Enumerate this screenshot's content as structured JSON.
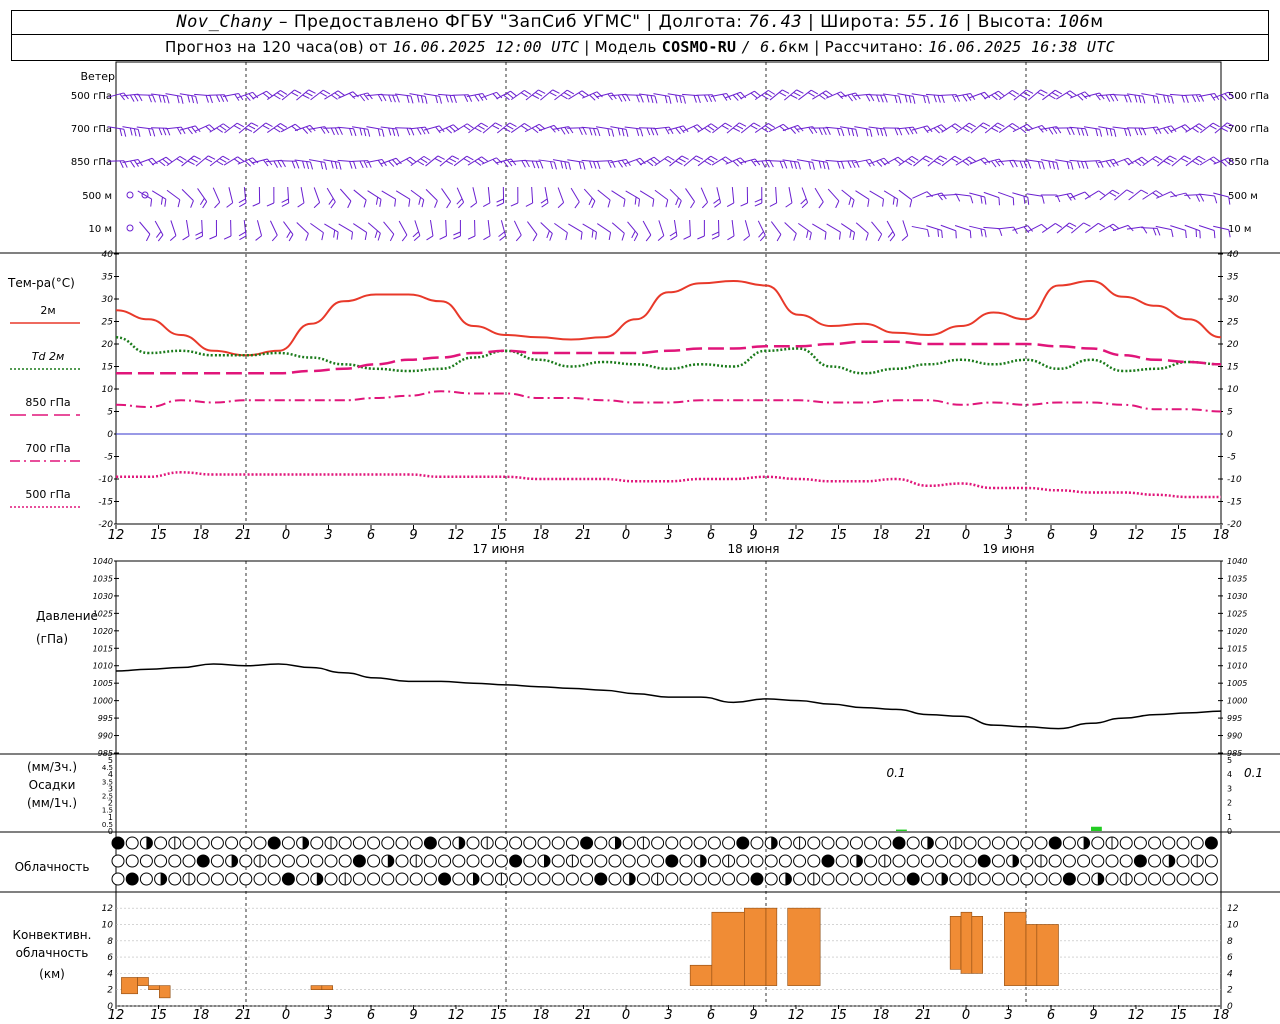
{
  "header": {
    "station": "Nov_Chany",
    "provider": "– Предоставлено ФГБУ \"ЗапСиб УГМС\" |",
    "lon_label": "Долгота:",
    "lon_value": "76.43",
    "lat_label": "| Широта:",
    "lat_value": "55.16",
    "alt_label": "| Высота:",
    "alt_value": "106",
    "alt_unit": "м",
    "forecast_label": "Прогноз на 120 часа(ов) от",
    "forecast_start": "16.06.2025 12:00 UTC",
    "model_label": "| Модель",
    "model_name": "COSMO-RU",
    "model_res": "/ 6.6",
    "model_res_unit": "км",
    "calc_label": "| Рассчитано:",
    "calc_time": "16.06.2025 16:38 UTC"
  },
  "wind_panel": {
    "title": "Ветер",
    "levels": [
      "500 гПа",
      "700 гПа",
      "850 гПа",
      "500 м",
      "10 м"
    ],
    "right_levels": [
      "500 гПа",
      "700 гПа",
      "850 гПа",
      "500 м",
      "10 м"
    ]
  },
  "temp_panel": {
    "title": "Тем-ра(°C)",
    "legend": [
      {
        "label": "2м",
        "style": "solid",
        "color": "#e8392a"
      },
      {
        "label": "Td  2м",
        "style": "dotted-green",
        "color": "#1a7a1a"
      },
      {
        "label": "850 гПа",
        "style": "longdash",
        "color": "#e0157a"
      },
      {
        "label": "700 гПа",
        "style": "dashdot",
        "color": "#e0157a"
      },
      {
        "label": "500 гПа",
        "style": "dotted",
        "color": "#e0157a"
      }
    ]
  },
  "pressure_panel": {
    "title1": "Давление",
    "title2": "(гПа)"
  },
  "precip_panel": {
    "title1": "(мм/3ч.)",
    "title2": "Осадки",
    "title3": "(мм/1ч.)",
    "annotations": [
      {
        "hour": 72,
        "text": "0.1"
      },
      {
        "hour": 105,
        "text": "0.1"
      }
    ]
  },
  "cloud_panel": {
    "title": "Облачность"
  },
  "conv_panel": {
    "title1": "Конвективн.",
    "title2": "облачность",
    "title3": "(км)"
  },
  "time_axis": {
    "hour_labels": [
      "12",
      "15",
      "18",
      "21",
      "0",
      "3",
      "6",
      "9",
      "12",
      "15",
      "18",
      "21",
      "0",
      "3",
      "6",
      "9",
      "12",
      "15",
      "18",
      "21",
      "0",
      "3",
      "6",
      "9",
      "12",
      "15",
      "18"
    ],
    "date_labels": [
      {
        "hour": 36,
        "text": "17 июня"
      },
      {
        "hour": 60,
        "text": "18 июня"
      },
      {
        "hour": 84,
        "text": "19 июня"
      }
    ]
  },
  "colors": {
    "t2m": "#e8392a",
    "td2m": "#1a7a1a",
    "isobaric": "#e0157a",
    "pressure": "#000000",
    "precip": "#22cc22",
    "convective": "#f08c35",
    "convective_edge": "#8c4a10",
    "wind": "#6a1fd0",
    "zero_line": "#3333cc"
  },
  "chart_data": [
    {
      "type": "line",
      "title": "Тем-ра(°C)",
      "ylim": [
        -20,
        40
      ],
      "x_unit": "hours since 16.06.2025 12:00 UTC",
      "x": [
        0,
        3,
        6,
        9,
        12,
        15,
        18,
        21,
        24,
        27,
        30,
        33,
        36,
        39,
        42,
        45,
        48,
        51,
        54,
        57,
        60,
        63,
        66,
        69,
        72,
        75,
        78,
        81,
        84,
        87,
        90,
        93,
        96,
        99,
        102
      ],
      "series": [
        {
          "name": "2м",
          "values": [
            27.5,
            25.5,
            22,
            18.5,
            17.5,
            18.5,
            24.5,
            29.5,
            31,
            31,
            29.5,
            24,
            22,
            21.5,
            21,
            21.5,
            25.5,
            31.5,
            33.5,
            34,
            33,
            26.5,
            24,
            24.5,
            22.5,
            22,
            24,
            27,
            25.5,
            33,
            34,
            30.5,
            28.5,
            25.5,
            21.5
          ]
        },
        {
          "name": "Td  2м",
          "values": [
            21.5,
            18,
            18.5,
            17.5,
            17.5,
            18,
            17,
            15.5,
            14.5,
            14,
            14.5,
            17,
            18.5,
            16.5,
            15,
            16,
            15.5,
            14.5,
            15.5,
            15,
            18.5,
            19,
            15,
            13.5,
            14.5,
            15.5,
            16.5,
            15.5,
            16.5,
            14.5,
            16.5,
            14,
            14.5,
            16,
            15.5
          ]
        },
        {
          "name": "850 гПа",
          "values": [
            13.5,
            13.5,
            13.5,
            13.5,
            13.5,
            13.5,
            14,
            14.5,
            15.5,
            16.5,
            17,
            18,
            18.5,
            18,
            18,
            18,
            18,
            18.5,
            19,
            19,
            19.5,
            19.5,
            20,
            20.5,
            20.5,
            20,
            20,
            20,
            20,
            19.5,
            19,
            17.5,
            16.5,
            16,
            15.5
          ]
        },
        {
          "name": "700 гПа",
          "values": [
            6.5,
            6,
            7.5,
            7,
            7.5,
            7.5,
            7.5,
            7.5,
            8,
            8.5,
            9.5,
            9,
            9,
            8,
            8,
            7.5,
            7,
            7,
            7.5,
            7.5,
            7.5,
            7.5,
            7,
            7,
            7.5,
            7.5,
            6.5,
            7,
            6.5,
            7,
            7,
            6.5,
            5.5,
            5.5,
            5
          ]
        },
        {
          "name": "500 гПа",
          "values": [
            -9.5,
            -9.5,
            -8.5,
            -9,
            -9,
            -9,
            -9,
            -9,
            -9,
            -9,
            -9.5,
            -9.5,
            -9.5,
            -10,
            -10,
            -10,
            -10.5,
            -10.5,
            -10,
            -10,
            -9.5,
            -10,
            -10.5,
            -10.5,
            -10,
            -11.5,
            -11,
            -12,
            -12,
            -12.5,
            -13,
            -13,
            -13.5,
            -14,
            -14
          ]
        }
      ]
    },
    {
      "type": "line",
      "title": "Давление (гПа)",
      "ylim": [
        985,
        1040
      ],
      "x_unit": "hours since 16.06.2025 12:00 UTC",
      "x": [
        0,
        3,
        6,
        9,
        12,
        15,
        18,
        21,
        24,
        27,
        30,
        33,
        36,
        39,
        42,
        45,
        48,
        51,
        54,
        57,
        60,
        63,
        66,
        69,
        72,
        75,
        78,
        81,
        84,
        87,
        90,
        93,
        96,
        99,
        102
      ],
      "series": [
        {
          "name": "Давление",
          "values": [
            1008.5,
            1009,
            1009.5,
            1010.5,
            1010,
            1010.5,
            1009.5,
            1008,
            1006.5,
            1005.5,
            1005.5,
            1005,
            1004.5,
            1004,
            1003.5,
            1003,
            1002,
            1001,
            1001,
            999.5,
            1000.5,
            1000,
            999,
            998,
            997.5,
            996,
            995.5,
            993,
            992.5,
            992,
            993.5,
            995,
            996,
            996.5,
            997
          ]
        }
      ]
    },
    {
      "type": "bar",
      "title": "Осадки (мм/3ч.)",
      "ylim": [
        0,
        5
      ],
      "x_unit": "hours since 16.06.2025 12:00 UTC",
      "bars": [
        {
          "x0": 72,
          "x1": 73,
          "value": 0.1
        },
        {
          "x0": 90,
          "x1": 91,
          "value": 0.3
        }
      ]
    },
    {
      "type": "bar",
      "title": "Конвективн. облачность (км)",
      "ylim": [
        0,
        13
      ],
      "x_unit": "hours since 16.06.2025 12:00 UTC",
      "bars": [
        {
          "x0": 0.5,
          "x1": 2,
          "bottom": 1.5,
          "top": 3.5
        },
        {
          "x0": 2,
          "x1": 3,
          "bottom": 2.5,
          "top": 3.5
        },
        {
          "x0": 3,
          "x1": 4,
          "bottom": 2.5,
          "top": 2.5
        },
        {
          "x0": 4,
          "x1": 5,
          "bottom": 1,
          "top": 2.5
        },
        {
          "x0": 18,
          "x1": 19,
          "bottom": 2,
          "top": 2.5
        },
        {
          "x0": 19,
          "x1": 20,
          "bottom": 2,
          "top": 2.5
        },
        {
          "x0": 53,
          "x1": 55,
          "bottom": 2.5,
          "top": 5
        },
        {
          "x0": 55,
          "x1": 58,
          "bottom": 2.5,
          "top": 11.5
        },
        {
          "x0": 58,
          "x1": 60,
          "bottom": 2.5,
          "top": 12
        },
        {
          "x0": 60,
          "x1": 61,
          "bottom": 2.5,
          "top": 12
        },
        {
          "x0": 62,
          "x1": 65,
          "bottom": 2.5,
          "top": 12
        },
        {
          "x0": 77,
          "x1": 78,
          "bottom": 4.5,
          "top": 11
        },
        {
          "x0": 78,
          "x1": 79,
          "bottom": 4,
          "top": 11.5
        },
        {
          "x0": 79,
          "x1": 80,
          "bottom": 4,
          "top": 11
        },
        {
          "x0": 82,
          "x1": 84,
          "bottom": 2.5,
          "top": 11.5
        },
        {
          "x0": 84,
          "x1": 85,
          "bottom": 2.5,
          "top": 10
        },
        {
          "x0": 85,
          "x1": 87,
          "bottom": 2.5,
          "top": 10
        }
      ]
    }
  ]
}
